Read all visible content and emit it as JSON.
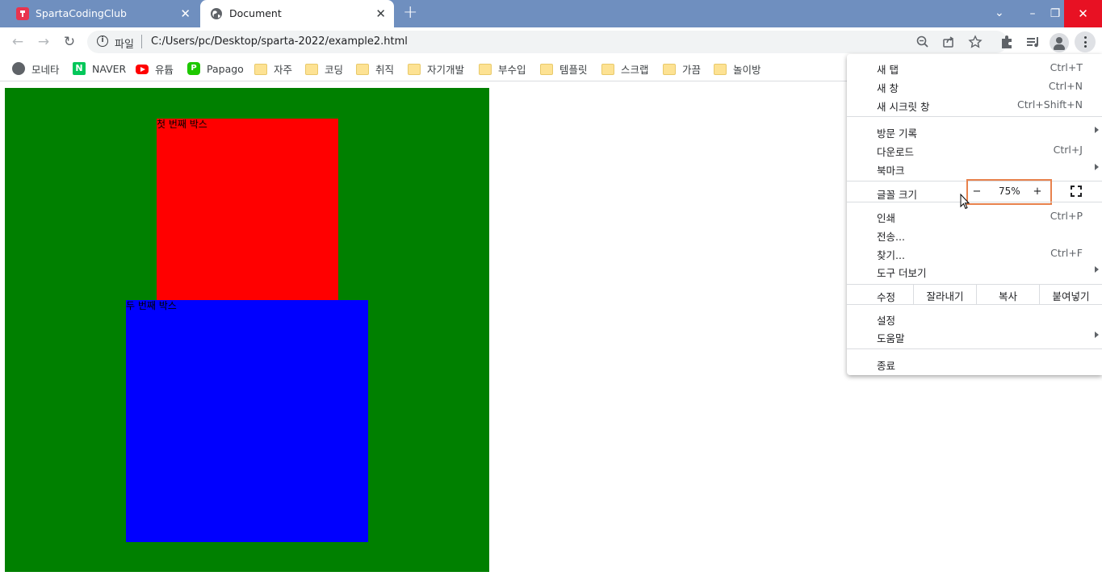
{
  "tabs": [
    {
      "title": "SpartaCodingClub",
      "active": false,
      "favicon": "sparta-icon"
    },
    {
      "title": "Document",
      "active": true,
      "favicon": "globe-icon"
    }
  ],
  "toolbar": {
    "url_scheme": "파일",
    "url": "C:/Users/pc/Desktop/sparta-2022/example2.html"
  },
  "bookmarks": [
    {
      "label": "모네타",
      "icon": "globe-icon"
    },
    {
      "label": "NAVER",
      "icon": "naver-icon"
    },
    {
      "label": "유튭",
      "icon": "youtube-icon"
    },
    {
      "label": "Papago",
      "icon": "papago-icon"
    },
    {
      "label": "자주",
      "icon": "folder-icon"
    },
    {
      "label": "코딩",
      "icon": "folder-icon"
    },
    {
      "label": "취직",
      "icon": "folder-icon"
    },
    {
      "label": "자기개발",
      "icon": "folder-icon"
    },
    {
      "label": "부수입",
      "icon": "folder-icon"
    },
    {
      "label": "템플릿",
      "icon": "folder-icon"
    },
    {
      "label": "스크랩",
      "icon": "folder-icon"
    },
    {
      "label": "가끔",
      "icon": "folder-icon"
    },
    {
      "label": "놀이방",
      "icon": "folder-icon"
    }
  ],
  "page": {
    "box1_text": "첫 번째 박스",
    "box2_text": "두 번째 박스",
    "colors": {
      "outer": "#008000",
      "box1": "#ff0000",
      "box2": "#0000ff"
    }
  },
  "menu": {
    "new_tab": {
      "label": "새 탭",
      "shortcut": "Ctrl+T"
    },
    "new_window": {
      "label": "새 창",
      "shortcut": "Ctrl+N"
    },
    "incognito": {
      "label": "새 시크릿 창",
      "shortcut": "Ctrl+Shift+N"
    },
    "history": {
      "label": "방문 기록"
    },
    "downloads": {
      "label": "다운로드",
      "shortcut": "Ctrl+J"
    },
    "bookmarks": {
      "label": "북마크"
    },
    "zoom": {
      "label": "글꼴 크기",
      "minus": "−",
      "value": "75%",
      "plus": "+"
    },
    "print": {
      "label": "인쇄",
      "shortcut": "Ctrl+P"
    },
    "cast": {
      "label": "전송..."
    },
    "find": {
      "label": "찾기...",
      "shortcut": "Ctrl+F"
    },
    "more_tools": {
      "label": "도구 더보기"
    },
    "edit": {
      "label": "수정",
      "cut": "잘라내기",
      "copy": "복사",
      "paste": "붙여넣기"
    },
    "settings": {
      "label": "설정"
    },
    "help": {
      "label": "도움말"
    },
    "exit": {
      "label": "종료"
    }
  }
}
